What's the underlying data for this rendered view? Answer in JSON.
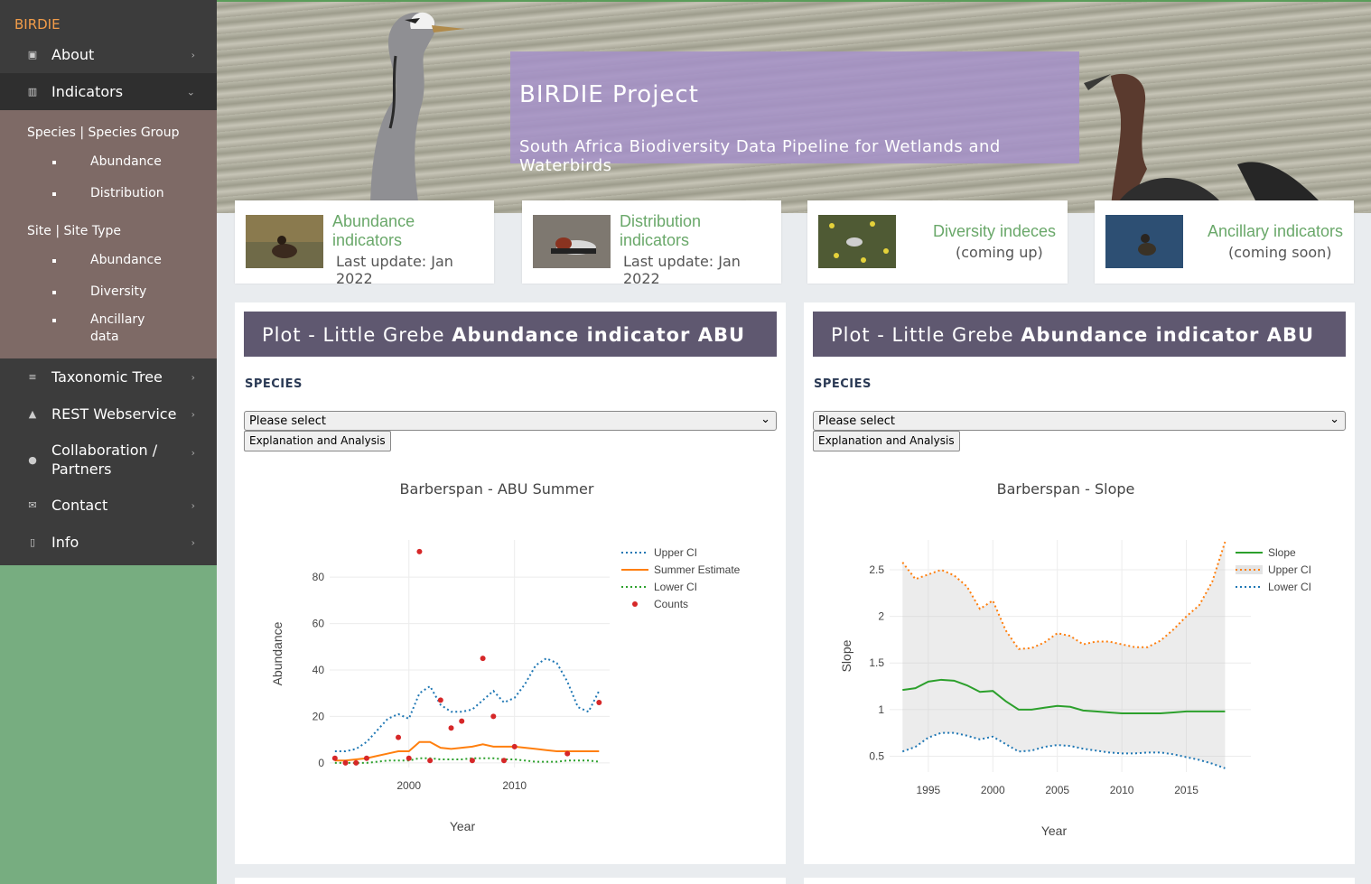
{
  "sidebar": {
    "brand": "BIRDIE",
    "about": "About",
    "indicators": "Indicators",
    "species_head": "Species | Species Group",
    "species_items": [
      "Abundance",
      "Distribution"
    ],
    "site_head": "Site | Site Type",
    "site_items": [
      "Abundance",
      "Diversity",
      "Ancillary data"
    ],
    "taxonomic": "Taxonomic Tree",
    "rest": "REST Webservice",
    "collab_l1": "Collaboration /",
    "collab_l2": "Partners",
    "contact": "Contact",
    "info": "Info",
    "icons": [
      "image-icon",
      "bar-chart-icon",
      "list-icon",
      "graduation-cap-icon",
      "users-icon",
      "envelope-icon",
      "file-icon",
      "chevron-right-icon",
      "chevron-down-icon"
    ]
  },
  "hero": {
    "title": "BIRDIE Project",
    "subtitle": "South Africa Biodiversity Data Pipeline for Wetlands and Waterbirds"
  },
  "cards": [
    {
      "title_l1": "Abundance",
      "title_l2": "indicators",
      "sub": "Last update: Jan 2022"
    },
    {
      "title_l1": "Distribution",
      "title_l2": "indicators",
      "sub": "Last update: Jan 2022"
    },
    {
      "title_l1": "Diversity indeces",
      "title_l2": "",
      "sub": "(coming up)"
    },
    {
      "title_l1": "Ancillary indicators",
      "title_l2": "",
      "sub": "(coming soon)"
    }
  ],
  "panels": [
    {
      "head_pre": "Plot - Little Grebe ",
      "head_bold": "Abundance indicator ABU Summer",
      "label": "SPECIES",
      "select": "Please select",
      "button": "Explanation and Analysis",
      "chart_title": "Barberspan - ABU Summer"
    },
    {
      "head_pre": "Plot - Little Grebe ",
      "head_bold": "Abundance indicator ABU Slope",
      "label": "SPECIES",
      "select": "Please select",
      "button": "Explanation and Analysis",
      "chart_title": "Barberspan - Slope"
    }
  ],
  "colors": {
    "sidebar_dark": "#3c3c3c",
    "submenu": "#7e6a66",
    "sidebar_green": "#77ad80",
    "brand": "#f29c49",
    "panel_header": "#5f5870",
    "hero_box": "#a491c8",
    "card_title": "#6aa86a"
  },
  "chart_data": [
    {
      "type": "line",
      "title": "Barberspan - ABU Summer",
      "xlabel": "Year",
      "ylabel": "Abundance",
      "xlim": [
        1992.5,
        2019
      ],
      "ylim": [
        -2,
        96
      ],
      "xticks": [
        2000,
        2010
      ],
      "yticks": [
        0,
        20,
        40,
        60,
        80
      ],
      "legend": "top-right",
      "grid": true,
      "x": [
        1993,
        1994,
        1995,
        1996,
        1997,
        1998,
        1999,
        2000,
        2001,
        2002,
        2003,
        2004,
        2005,
        2006,
        2007,
        2008,
        2009,
        2010,
        2011,
        2012,
        2013,
        2014,
        2015,
        2016,
        2017,
        2018
      ],
      "series": [
        {
          "name": "Upper CI",
          "style": "dotted",
          "color": "#1f77b4",
          "values": [
            5,
            5,
            6,
            9,
            14,
            19,
            21,
            19,
            30,
            33,
            25,
            22,
            22,
            23,
            27,
            31,
            26,
            28,
            34,
            42,
            45,
            43,
            35,
            24,
            22,
            31
          ]
        },
        {
          "name": "Summer Estimate",
          "style": "solid",
          "color": "#ff7f0e",
          "values": [
            1,
            1,
            1.5,
            2,
            3,
            4,
            5,
            5,
            9,
            9,
            6.5,
            6,
            6.5,
            7,
            8,
            7,
            7,
            7,
            6.5,
            6,
            5.5,
            5,
            5,
            5,
            5,
            5
          ]
        },
        {
          "name": "Lower CI",
          "style": "dotted",
          "color": "#2ca02c",
          "values": [
            0,
            0,
            0,
            0,
            0.5,
            1,
            1,
            1,
            2,
            2,
            1.5,
            1.5,
            1.5,
            2,
            2,
            2,
            1.5,
            1.5,
            1,
            0.5,
            0.5,
            0.5,
            1,
            1,
            1,
            0.5
          ]
        },
        {
          "name": "Counts",
          "style": "markers",
          "color": "#d62728",
          "points": [
            [
              1993,
              2
            ],
            [
              1994,
              0
            ],
            [
              1995,
              0
            ],
            [
              1996,
              2
            ],
            [
              1999,
              11
            ],
            [
              2000,
              2
            ],
            [
              2001,
              91
            ],
            [
              2002,
              1
            ],
            [
              2003,
              27
            ],
            [
              2004,
              15
            ],
            [
              2005,
              18
            ],
            [
              2006,
              1
            ],
            [
              2007,
              45
            ],
            [
              2008,
              20
            ],
            [
              2009,
              1
            ],
            [
              2010,
              7
            ],
            [
              2015,
              4
            ],
            [
              2018,
              26
            ]
          ]
        }
      ]
    },
    {
      "type": "line",
      "title": "Barberspan - Slope",
      "xlabel": "Year",
      "ylabel": "Slope",
      "xlim": [
        1992,
        2020
      ],
      "ylim": [
        0.33,
        2.82
      ],
      "xticks": [
        1995,
        2000,
        2005,
        2010,
        2015
      ],
      "yticks": [
        0.5,
        1,
        1.5,
        2,
        2.5
      ],
      "legend": "top-right",
      "grid": true,
      "x": [
        1993,
        1994,
        1995,
        1996,
        1997,
        1998,
        1999,
        2000,
        2001,
        2002,
        2003,
        2004,
        2005,
        2006,
        2007,
        2008,
        2009,
        2010,
        2011,
        2012,
        2013,
        2014,
        2015,
        2016,
        2017,
        2018
      ],
      "series": [
        {
          "name": "Slope",
          "style": "solid",
          "color": "#2ca02c",
          "values": [
            1.21,
            1.23,
            1.3,
            1.32,
            1.31,
            1.26,
            1.19,
            1.2,
            1.09,
            1.0,
            1.0,
            1.02,
            1.04,
            1.03,
            0.99,
            0.98,
            0.97,
            0.96,
            0.96,
            0.96,
            0.96,
            0.97,
            0.98,
            0.98,
            0.98,
            0.98
          ]
        },
        {
          "name": "Upper CI",
          "style": "dotted",
          "color": "#ff7f0e",
          "values": [
            2.58,
            2.4,
            2.45,
            2.5,
            2.44,
            2.32,
            2.08,
            2.17,
            1.85,
            1.65,
            1.66,
            1.72,
            1.82,
            1.79,
            1.7,
            1.73,
            1.73,
            1.7,
            1.67,
            1.67,
            1.74,
            1.86,
            2.0,
            2.12,
            2.37,
            2.8
          ]
        },
        {
          "name": "Lower CI",
          "style": "dotted",
          "color": "#1f77b4",
          "values": [
            0.55,
            0.6,
            0.7,
            0.75,
            0.75,
            0.72,
            0.68,
            0.71,
            0.63,
            0.55,
            0.56,
            0.6,
            0.62,
            0.61,
            0.58,
            0.56,
            0.54,
            0.53,
            0.53,
            0.54,
            0.54,
            0.52,
            0.49,
            0.46,
            0.42,
            0.37
          ]
        }
      ]
    }
  ]
}
